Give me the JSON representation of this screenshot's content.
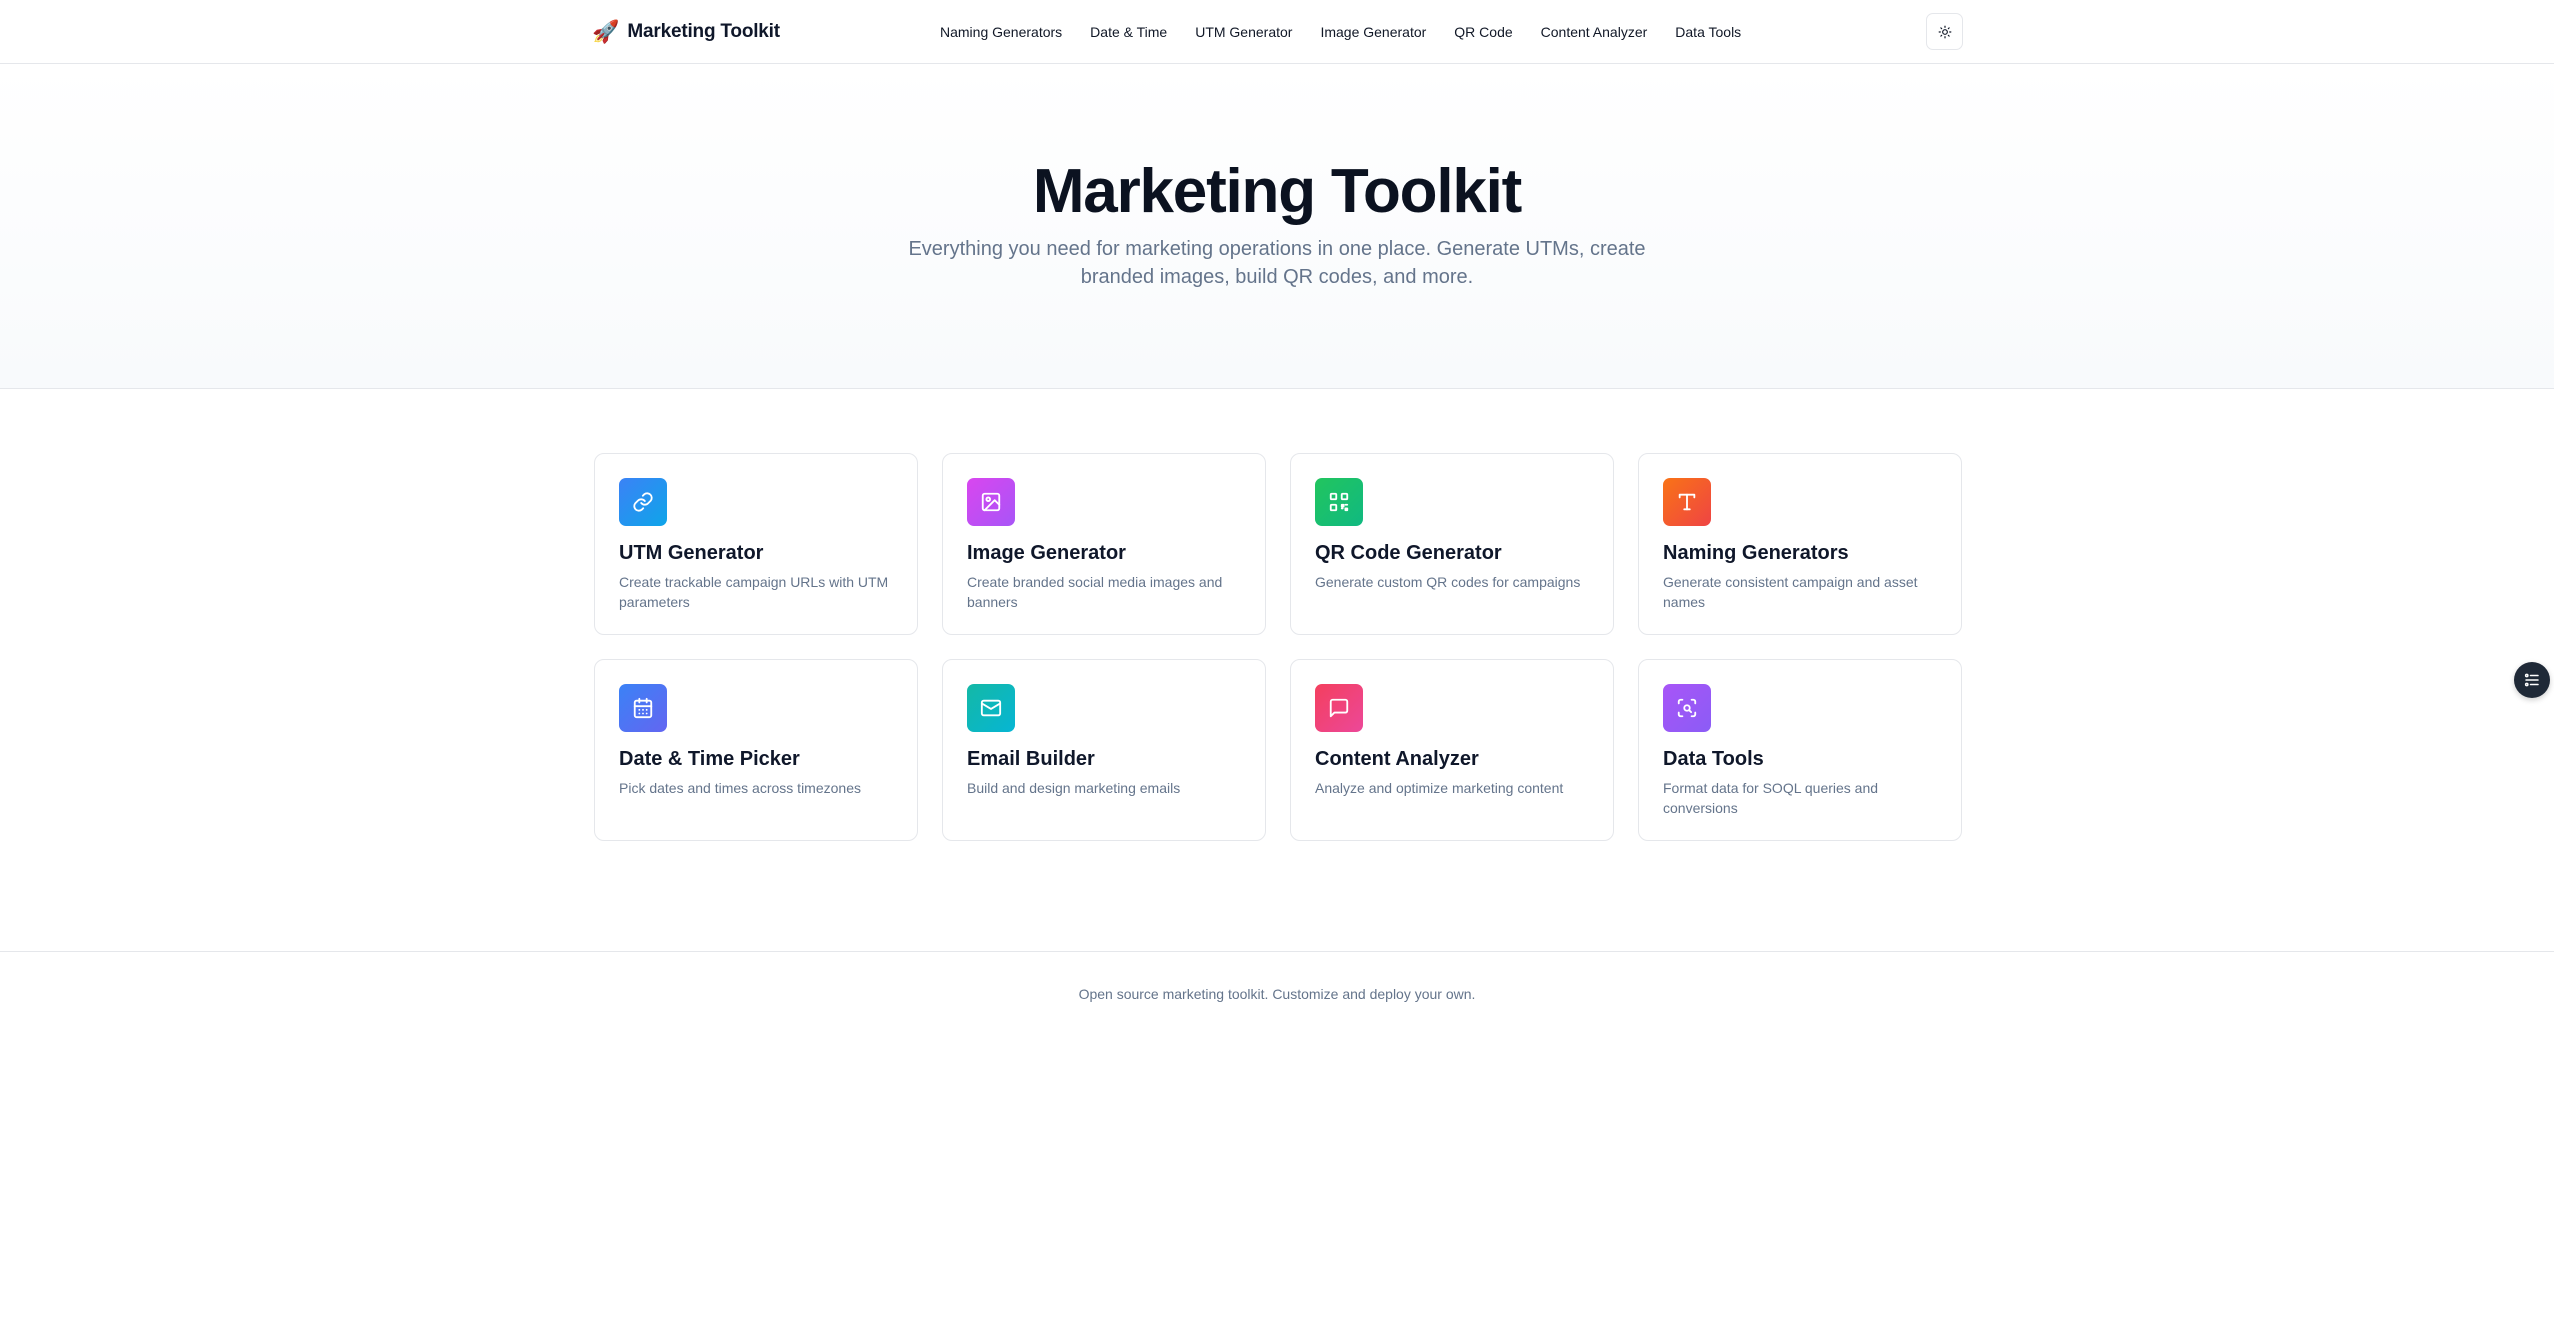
{
  "header": {
    "brand_emoji": "🚀",
    "brand_name": "Marketing Toolkit",
    "nav": [
      {
        "label": "Naming Generators"
      },
      {
        "label": "Date & Time"
      },
      {
        "label": "UTM Generator"
      },
      {
        "label": "Image Generator"
      },
      {
        "label": "QR Code"
      },
      {
        "label": "Content Analyzer"
      },
      {
        "label": "Data Tools"
      }
    ],
    "theme_toggle_icon": "sun-icon"
  },
  "hero": {
    "title": "Marketing Toolkit",
    "subtitle": "Everything you need for marketing operations in one place. Generate UTMs, create branded images, build QR codes, and more."
  },
  "cards": [
    {
      "title": "UTM Generator",
      "description": "Create trackable campaign URLs with UTM parameters",
      "icon": "link-icon",
      "color": "#3b82f6"
    },
    {
      "title": "Image Generator",
      "description": "Create branded social media images and banners",
      "icon": "image-icon",
      "color": "#c026d3"
    },
    {
      "title": "QR Code Generator",
      "description": "Generate custom QR codes for campaigns",
      "icon": "qr-code-icon",
      "color": "#16a34a"
    },
    {
      "title": "Naming Generators",
      "description": "Generate consistent campaign and asset names",
      "icon": "type-icon",
      "color": "#f97316"
    },
    {
      "title": "Date & Time Picker",
      "description": "Pick dates and times across timezones",
      "icon": "calendar-icon",
      "color": "#4f6ef7"
    },
    {
      "title": "Email Builder",
      "description": "Build and design marketing emails",
      "icon": "mail-icon",
      "color": "#0ea5a5"
    },
    {
      "title": "Content Analyzer",
      "description": "Analyze and optimize marketing content",
      "icon": "message-icon",
      "color": "#f43f5e"
    },
    {
      "title": "Data Tools",
      "description": "Format data for SOQL queries and conversions",
      "icon": "scan-icon",
      "color": "#8b5cf6"
    }
  ],
  "footer": {
    "text": "Open source marketing toolkit. Customize and deploy your own."
  },
  "fab": {
    "icon": "list-settings-icon"
  }
}
